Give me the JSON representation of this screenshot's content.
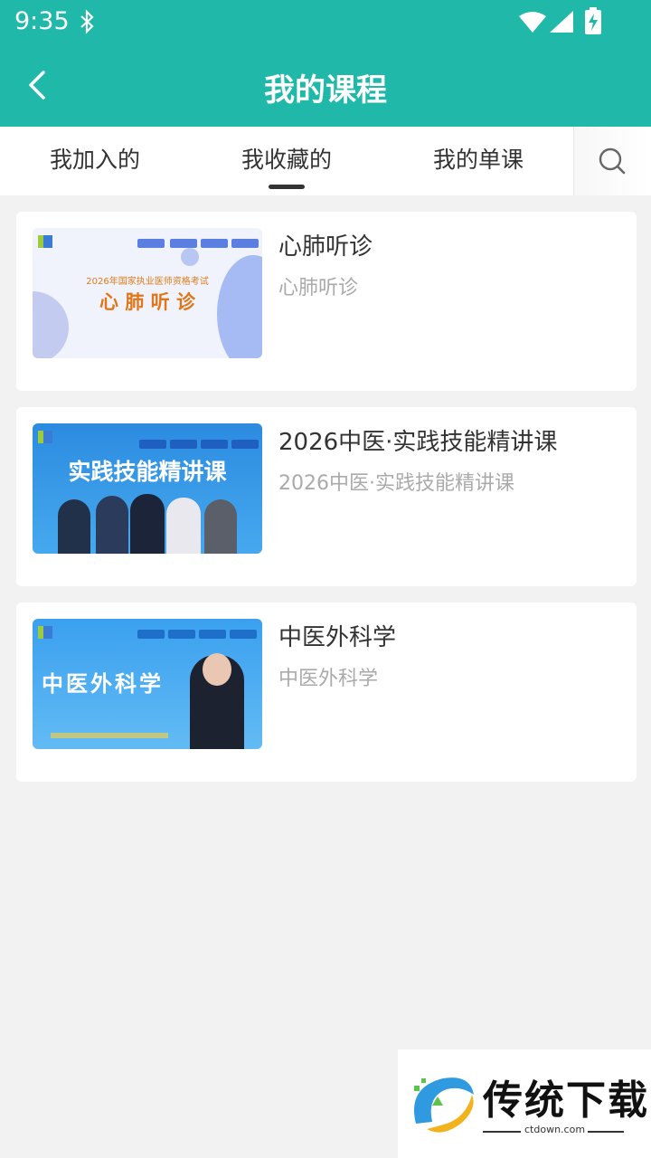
{
  "status_bar": {
    "time": "9:35"
  },
  "header": {
    "title": "我的课程"
  },
  "tabs": [
    {
      "label": "我加入的",
      "active": false
    },
    {
      "label": "我收藏的",
      "active": true
    },
    {
      "label": "我的单课",
      "active": false
    }
  ],
  "courses": [
    {
      "title": "心肺听诊",
      "subtitle": "心肺听诊",
      "thumb": {
        "heading": "2026年国家执业医师资格考试",
        "main": "心 肺 听 诊"
      }
    },
    {
      "title": "2026中医·实践技能精讲课",
      "subtitle": "2026中医·实践技能精讲课",
      "thumb": {
        "main": "实践技能精讲课"
      }
    },
    {
      "title": "中医外科学",
      "subtitle": "中医外科学",
      "thumb": {
        "main": "中医外科学"
      }
    }
  ],
  "watermark": {
    "name": "传统下载",
    "url": "ctdown.com"
  },
  "colors": {
    "primary": "#1fb8a9",
    "background": "#f2f2f2"
  }
}
